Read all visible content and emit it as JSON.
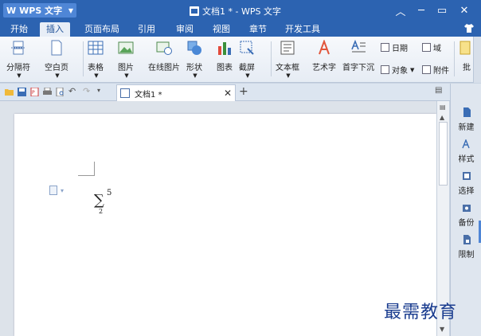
{
  "app": {
    "name": "WPS 文字",
    "logo": "W"
  },
  "window": {
    "title": "文档1 * - WPS 文字"
  },
  "tabs": [
    {
      "label": "开始"
    },
    {
      "label": "插入",
      "active": true
    },
    {
      "label": "页面布局"
    },
    {
      "label": "引用"
    },
    {
      "label": "审阅"
    },
    {
      "label": "视图"
    },
    {
      "label": "章节"
    },
    {
      "label": "开发工具"
    }
  ],
  "ribbon": {
    "page_break": "分隔符",
    "blank_page": "空白页",
    "table": "表格",
    "picture": "图片",
    "online_picture": "在线图片",
    "shapes": "形状",
    "chart": "图表",
    "screenshot": "截屏",
    "textbox": "文本框",
    "wordart": "艺术字",
    "dropcap": "首字下沉",
    "date": "日期",
    "field": "域",
    "object": "对象",
    "attachment": "附件",
    "more": "批"
  },
  "doc_tab": {
    "label": "文档1 *"
  },
  "document": {
    "formula": {
      "operator": "∑",
      "superscript": "5",
      "subscript": "2"
    }
  },
  "taskpane": {
    "items": [
      {
        "label": "新建"
      },
      {
        "label": "样式"
      },
      {
        "label": "选择"
      },
      {
        "label": "备份"
      },
      {
        "label": "限制"
      }
    ]
  },
  "watermark": "最需教育",
  "colors": {
    "title_bar": "#2c63b1",
    "accent": "#4f86d6",
    "watermark": "#1a3c8f"
  }
}
